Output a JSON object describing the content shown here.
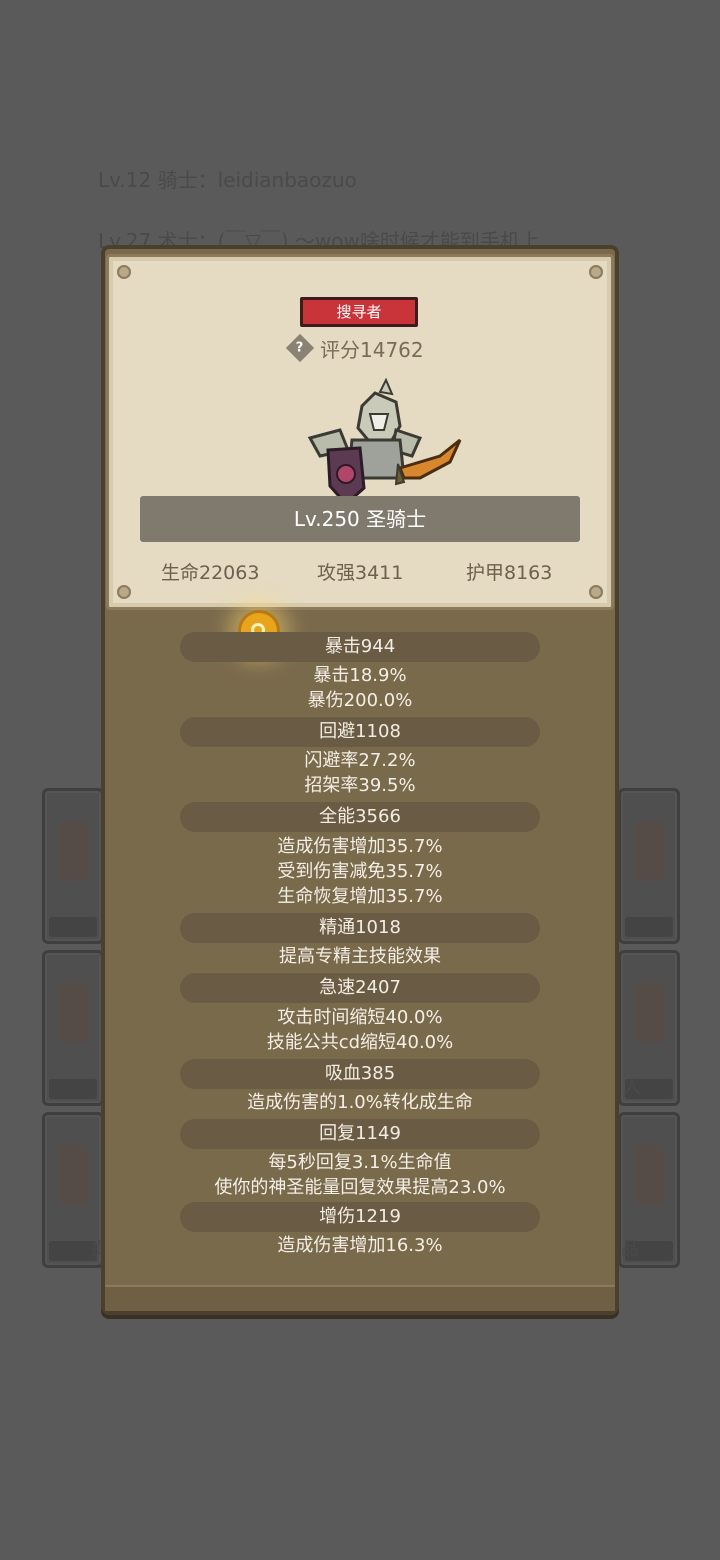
{
  "background": {
    "line1": "Lv.12 骑士：leidianbaozuo",
    "line2": "Lv.27 术士：(￣▽￣) ～wow啥时候才能到手机上",
    "side_labels": {
      "left": "提",
      "right_mid": "人",
      "right_bottom": "品"
    }
  },
  "profile": {
    "title_badge": "搜寻者",
    "score": "评分14762",
    "level_class": "Lv.250 圣骑士",
    "hp": "生命22063",
    "attack": "攻强3411",
    "armor": "护甲8163"
  },
  "stats": [
    {
      "header": "暴击944",
      "details": [
        "暴击18.9%",
        "暴伤200.0%"
      ]
    },
    {
      "header": "回避1108",
      "details": [
        "闪避率27.2%",
        "招架率39.5%"
      ]
    },
    {
      "header": "全能3566",
      "details": [
        "造成伤害增加35.7%",
        "受到伤害减免35.7%",
        "生命恢复增加35.7%"
      ]
    },
    {
      "header": "精通1018",
      "details": [
        "提高专精主技能效果"
      ]
    },
    {
      "header": "急速2407",
      "details": [
        "攻击时间缩短40.0%",
        "技能公共cd缩短40.0%"
      ]
    },
    {
      "header": "吸血385",
      "details": [
        "造成伤害的1.0%转化成生命"
      ]
    },
    {
      "header": "回复1149",
      "details": [
        "每5秒回复3.1%生命值",
        "使你的神圣能量回复效果提高23.0%"
      ]
    },
    {
      "header": "增伤1219",
      "details": [
        "造成伤害增加16.3%"
      ]
    }
  ],
  "colors": {
    "badge": "#c8343a",
    "panel": "#7a6a4c",
    "parchment": "#e5dbc2",
    "coin": "#e6a51d"
  }
}
